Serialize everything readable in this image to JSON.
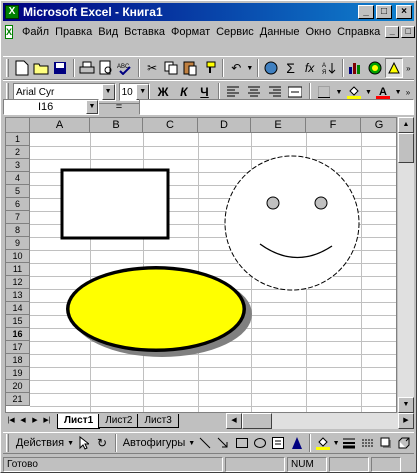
{
  "window": {
    "title": "Microsoft Excel - Книга1"
  },
  "menu": {
    "items": [
      "Файл",
      "Правка",
      "Вид",
      "Вставка",
      "Формат",
      "Сервис",
      "Данные",
      "Окно",
      "Справка"
    ]
  },
  "format": {
    "font_name": "Arial Cyr",
    "font_size": "10"
  },
  "formula_bar": {
    "cell_ref": "I16",
    "equals": "=",
    "content": ""
  },
  "columns": [
    "A",
    "B",
    "C",
    "D",
    "E",
    "F",
    "G"
  ],
  "rows": [
    "1",
    "2",
    "3",
    "4",
    "5",
    "6",
    "7",
    "8",
    "9",
    "10",
    "11",
    "12",
    "13",
    "14",
    "15",
    "16",
    "17",
    "18",
    "19",
    "20",
    "21"
  ],
  "sheets": [
    "Лист1",
    "Лист2",
    "Лист3"
  ],
  "drawing_toolbar": {
    "actions_label": "Действия",
    "autoshapes_label": "Автофигуры"
  },
  "status": {
    "ready": "Готово",
    "num": "NUM"
  },
  "colors": {
    "title_start": "#000080",
    "title_end": "#1084d0",
    "ellipse_fill": "#ffff00",
    "face_fill": "#c0c0c0"
  }
}
